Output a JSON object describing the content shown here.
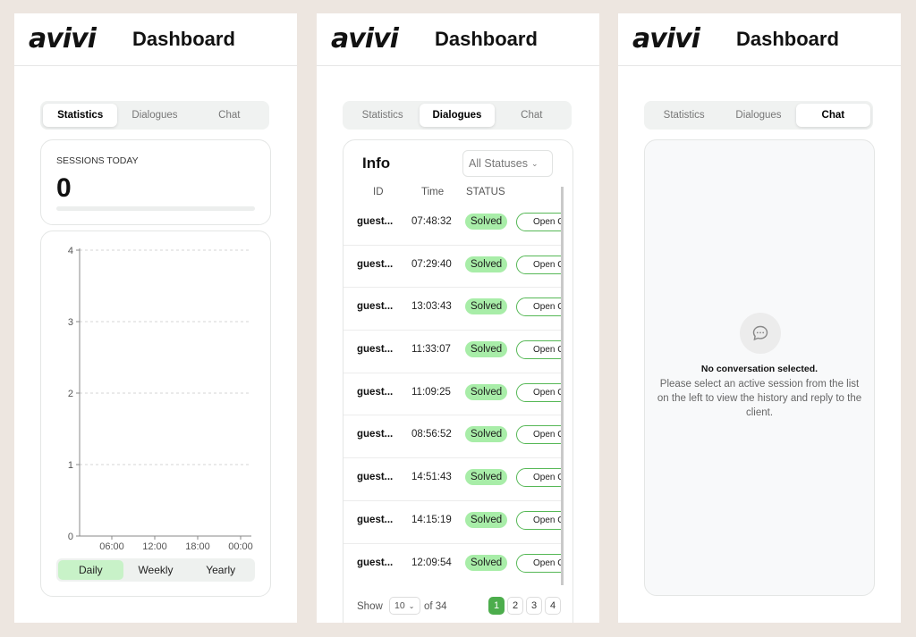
{
  "brand": {
    "logo": "avivi",
    "title": "Dashboard"
  },
  "tabs": [
    "Statistics",
    "Dialogues",
    "Chat"
  ],
  "statistics": {
    "sessions_label": "SESSIONS TODAY",
    "sessions_value": "0",
    "periods": [
      "Daily",
      "Weekly",
      "Yearly"
    ],
    "active_period": "Daily",
    "chart_data": {
      "type": "line",
      "x": [
        "06:00",
        "12:00",
        "18:00",
        "00:00"
      ],
      "y_ticks": [
        "0",
        "1",
        "2",
        "3",
        "4"
      ],
      "ylim": [
        0,
        4
      ],
      "series": [],
      "grid": true
    }
  },
  "dialogues": {
    "title": "Info",
    "status_filter": "All Statuses",
    "columns": [
      "ID",
      "Time",
      "STATUS"
    ],
    "rows": [
      {
        "id": "guest...",
        "time": "07:48:32",
        "status": "Solved",
        "action": "Open C"
      },
      {
        "id": "guest...",
        "time": "07:29:40",
        "status": "Solved",
        "action": "Open C"
      },
      {
        "id": "guest...",
        "time": "13:03:43",
        "status": "Solved",
        "action": "Open C"
      },
      {
        "id": "guest...",
        "time": "11:33:07",
        "status": "Solved",
        "action": "Open C"
      },
      {
        "id": "guest...",
        "time": "11:09:25",
        "status": "Solved",
        "action": "Open C"
      },
      {
        "id": "guest...",
        "time": "08:56:52",
        "status": "Solved",
        "action": "Open C"
      },
      {
        "id": "guest...",
        "time": "14:51:43",
        "status": "Solved",
        "action": "Open C"
      },
      {
        "id": "guest...",
        "time": "14:15:19",
        "status": "Solved",
        "action": "Open C"
      },
      {
        "id": "guest...",
        "time": "12:09:54",
        "status": "Solved",
        "action": "Open C"
      }
    ],
    "footer": {
      "show": "Show",
      "page_size": "10",
      "of": "of 34",
      "pages": [
        "1",
        "2",
        "3",
        "4"
      ],
      "active_page": "1"
    }
  },
  "chat": {
    "empty_title": "No conversation selected.",
    "empty_desc": "Please select an active session from the list on the left to view the history and reply to the client."
  },
  "colors": {
    "accent": "#4cad4c",
    "badge": "#a8eda8",
    "page_bg": "#ede6e0"
  }
}
